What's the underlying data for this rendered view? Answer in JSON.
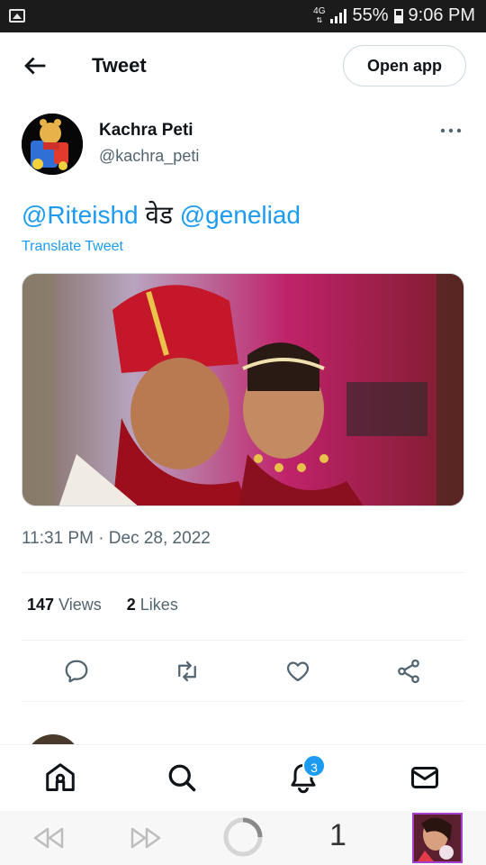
{
  "status_bar": {
    "network": "4G",
    "battery": "55%",
    "time": "9:06 PM"
  },
  "header": {
    "title": "Tweet",
    "open_app_label": "Open app"
  },
  "author": {
    "name": "Kachra Peti",
    "handle": "@kachra_peti"
  },
  "tweet": {
    "mention_1": "@Riteishd",
    "connector": " वेड ",
    "mention_2": "@geneliad",
    "translate_label": "Translate Tweet",
    "timestamp": "11:31 PM · Dec 28, 2022"
  },
  "stats": {
    "views_count": "147",
    "views_label": "Views",
    "likes_count": "2",
    "likes_label": "Likes"
  },
  "nav": {
    "notifications_badge": "3"
  },
  "browser": {
    "tab_count": "1"
  },
  "colors": {
    "accent": "#1d9bf0",
    "text": "#0f1419",
    "muted": "#536471",
    "divider": "#eff3f4"
  }
}
